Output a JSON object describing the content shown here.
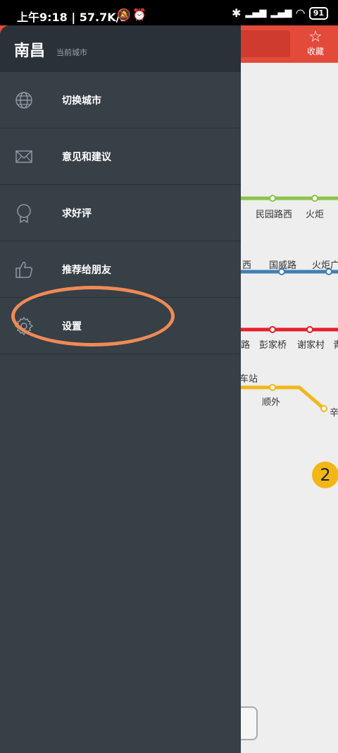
{
  "status": {
    "left": "上午9:18 | 57.7K/s",
    "battery": "91"
  },
  "app": {
    "favorite_label": "收藏",
    "line_badge": "2",
    "stations": {
      "minyuanluxi": "民园路西",
      "huoju": "火炬",
      "xi": "西",
      "guoweilu": "国威路",
      "huojuguang": "火炬广",
      "lu": "路",
      "pengjiaqiao": "彭家桥",
      "xiejiacun": "谢家村",
      "qing": "青",
      "chezhan": "车站",
      "shunwai": "顺外",
      "xin": "辛"
    }
  },
  "drawer": {
    "city": "南昌",
    "city_subtitle": "当前城市",
    "items": [
      {
        "label": "切换城市",
        "icon": "globe-icon"
      },
      {
        "label": "意见和建议",
        "icon": "mail-icon"
      },
      {
        "label": "求好评",
        "icon": "award-icon"
      },
      {
        "label": "推荐给朋友",
        "icon": "thumbs-up-icon"
      },
      {
        "label": "设置",
        "icon": "gear-icon"
      }
    ]
  },
  "colors": {
    "drawer_bg": "#373f47",
    "header_bg": "#2b3138",
    "topbar": "#e34a3a",
    "highlight": "#f08a55",
    "line_green": "#8bc34a",
    "line_blue": "#3f7fb3",
    "line_red": "#e5202c",
    "line_yellow": "#f2b716"
  }
}
